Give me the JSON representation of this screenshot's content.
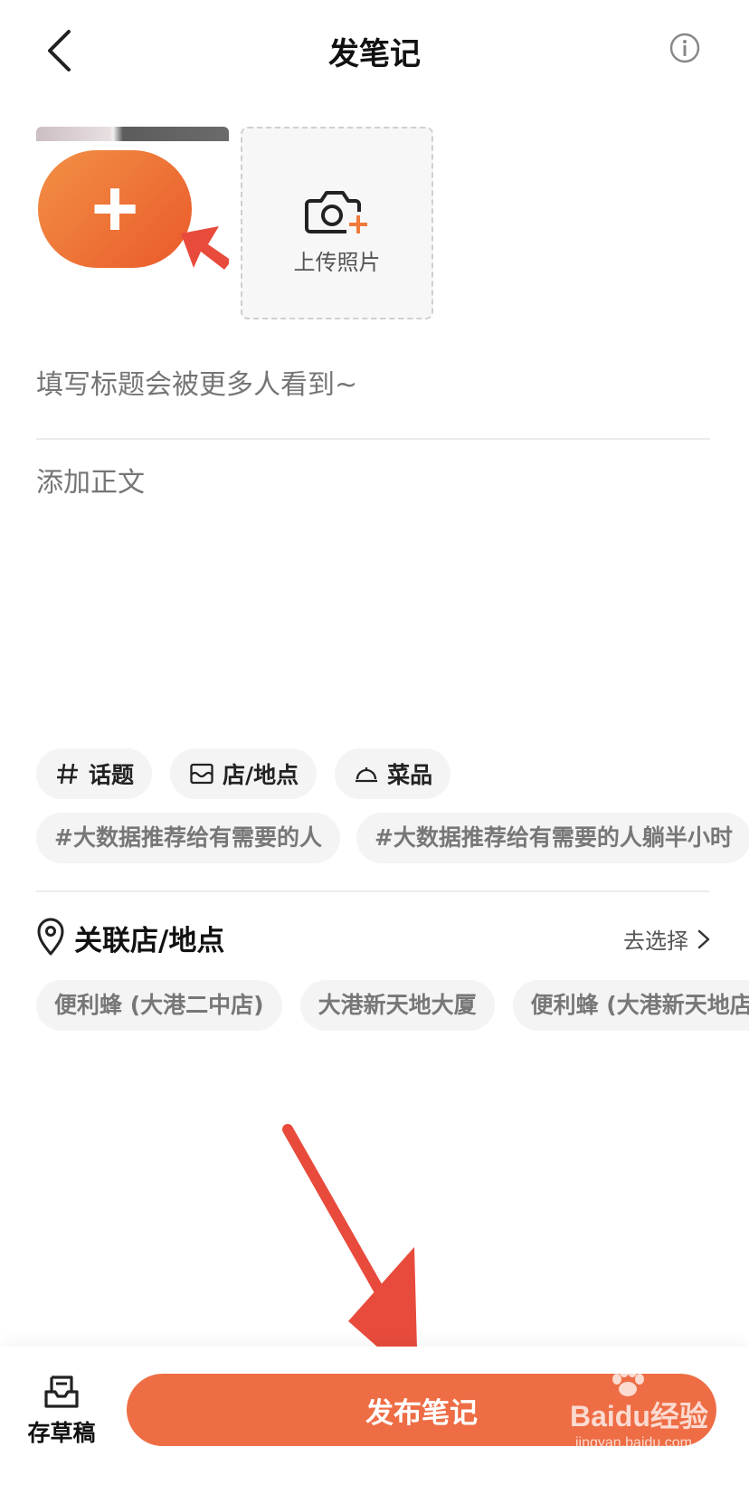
{
  "header": {
    "title": "发笔记"
  },
  "media": {
    "upload_label": "上传照片"
  },
  "editor": {
    "title_placeholder": "填写标题会被更多人看到~",
    "body_placeholder": "添加正文"
  },
  "tools": [
    {
      "label": "话题",
      "icon": "hashtag-icon"
    },
    {
      "label": "店/地点",
      "icon": "store-icon"
    },
    {
      "label": "菜品",
      "icon": "dish-cover-icon"
    }
  ],
  "topics": [
    "#大数据推荐给有需要的人",
    "#大数据推荐给有需要的人躺半小时"
  ],
  "location": {
    "title": "关联店/地点",
    "select_label": "去选择",
    "places": [
      "便利蜂 (大港二中店)",
      "大港新天地大厦",
      "便利蜂 (大港新天地店)"
    ]
  },
  "bottom": {
    "draft_label": "存草稿",
    "publish_label": "发布笔记"
  },
  "watermark": {
    "brand": "Baidu经验",
    "url": "jingyan.baidu.com"
  },
  "colors": {
    "accent": "#ee6d45",
    "annotation_arrow": "#e84b3c"
  }
}
